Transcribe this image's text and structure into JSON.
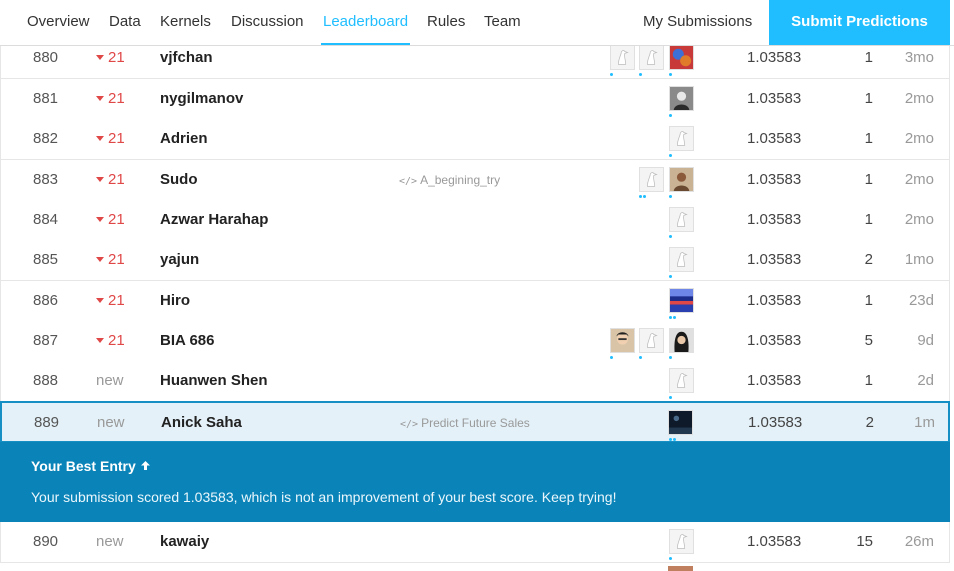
{
  "nav": {
    "tabs": [
      "Overview",
      "Data",
      "Kernels",
      "Discussion",
      "Leaderboard",
      "Rules",
      "Team"
    ],
    "active_tab": "Leaderboard",
    "my_submissions": "My Submissions",
    "submit_button": "Submit Predictions"
  },
  "colors": {
    "accent": "#20beff",
    "banner": "#0a84b8",
    "rank_down": "#e04848",
    "highlight_row": "#e4f1f8"
  },
  "leaderboard": {
    "rows": [
      {
        "rank": "880",
        "change": "21",
        "change_type": "down",
        "team": "vjfchan",
        "kernel": "",
        "avatars": [
          "default",
          "default",
          "colorful"
        ],
        "score": "1.03583",
        "entries": "1",
        "last": "3mo"
      },
      {
        "rank": "881",
        "change": "21",
        "change_type": "down",
        "team": "nygilmanov",
        "kernel": "",
        "avatars": [
          "person-dark"
        ],
        "score": "1.03583",
        "entries": "1",
        "last": "2mo"
      },
      {
        "rank": "882",
        "change": "21",
        "change_type": "down",
        "team": "Adrien",
        "kernel": "",
        "avatars": [
          "default"
        ],
        "score": "1.03583",
        "entries": "1",
        "last": "2mo"
      },
      {
        "rank": "883",
        "change": "21",
        "change_type": "down",
        "team": "Sudo",
        "kernel": "A_begining_try",
        "avatars": [
          "default",
          "person-photo"
        ],
        "score": "1.03583",
        "entries": "1",
        "last": "2mo"
      },
      {
        "rank": "884",
        "change": "21",
        "change_type": "down",
        "team": "Azwar Harahap",
        "kernel": "",
        "avatars": [
          "default"
        ],
        "score": "1.03583",
        "entries": "1",
        "last": "2mo"
      },
      {
        "rank": "885",
        "change": "21",
        "change_type": "down",
        "team": "yajun",
        "kernel": "",
        "avatars": [
          "default"
        ],
        "score": "1.03583",
        "entries": "2",
        "last": "1mo"
      },
      {
        "rank": "886",
        "change": "21",
        "change_type": "down",
        "team": "Hiro",
        "kernel": "",
        "avatars": [
          "landscape"
        ],
        "score": "1.03583",
        "entries": "1",
        "last": "23d"
      },
      {
        "rank": "887",
        "change": "21",
        "change_type": "down",
        "team": "BIA 686",
        "kernel": "",
        "avatars": [
          "person-glasses",
          "default",
          "person-dark-hair"
        ],
        "score": "1.03583",
        "entries": "5",
        "last": "9d"
      },
      {
        "rank": "888",
        "change": "new",
        "change_type": "new",
        "team": "Huanwen Shen",
        "kernel": "",
        "avatars": [
          "default"
        ],
        "score": "1.03583",
        "entries": "1",
        "last": "2d"
      },
      {
        "rank": "889",
        "change": "new",
        "change_type": "new",
        "team": "Anick Saha",
        "kernel": "Predict Future Sales",
        "avatars": [
          "dark-scene"
        ],
        "score": "1.03583",
        "entries": "2",
        "last": "1m"
      },
      {
        "rank": "890",
        "change": "new",
        "change_type": "new",
        "team": "kawaiy",
        "kernel": "",
        "avatars": [
          "default"
        ],
        "score": "1.03583",
        "entries": "15",
        "last": "26m"
      }
    ]
  },
  "banner": {
    "title": "Your Best Entry",
    "title_icon": "arrow-up-icon",
    "message": "Your submission scored 1.03583, which is not an improvement of your best score. Keep trying!"
  }
}
